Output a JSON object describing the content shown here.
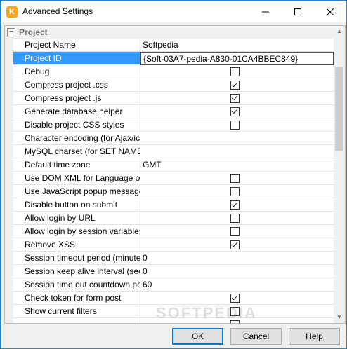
{
  "window": {
    "title": "Advanced Settings"
  },
  "titlebar": {
    "minimize": "—",
    "maximize": "☐",
    "close": "✕"
  },
  "category": {
    "label": "Project",
    "toggle": "−"
  },
  "rows": [
    {
      "name": "Project Name",
      "value": "Softpedia"
    },
    {
      "name": "Project ID",
      "value": "{Soft-03A7-pedia-A830-01CA4BBEC849}",
      "selected": true
    },
    {
      "name": "Debug",
      "checkbox": false
    },
    {
      "name": "Compress project .css",
      "checkbox": true
    },
    {
      "name": "Compress project .js",
      "checkbox": true
    },
    {
      "name": "Generate database helper",
      "checkbox": true
    },
    {
      "name": "Disable project CSS styles",
      "checkbox": false
    },
    {
      "name": "Character encoding (for Ajax/icon",
      "value": ""
    },
    {
      "name": "MySQL charset (for SET NAMES)",
      "value": ""
    },
    {
      "name": "Default time zone",
      "value": "GMT"
    },
    {
      "name": "Use DOM XML for Language objec",
      "checkbox": false
    },
    {
      "name": "Use JavaScript popup message",
      "checkbox": false
    },
    {
      "name": "Disable button on submit",
      "checkbox": true
    },
    {
      "name": "Allow login by URL",
      "checkbox": false
    },
    {
      "name": "Allow login by session variables",
      "checkbox": false
    },
    {
      "name": "Remove XSS",
      "checkbox": true
    },
    {
      "name": "Session timeout period (minutes)",
      "value": "0"
    },
    {
      "name": "Session keep alive interval (secon",
      "value": "0"
    },
    {
      "name": "Session time out countdown perio",
      "value": "60"
    },
    {
      "name": "Check token for form post",
      "checkbox": true
    },
    {
      "name": "Show current filters",
      "checkbox": false
    },
    {
      "name": "",
      "checkbox": false
    }
  ],
  "watermark": "SOFTPEDIA",
  "buttons": {
    "ok": "OK",
    "cancel": "Cancel",
    "help": "Help"
  },
  "icons": {
    "app": "app-icon",
    "scroll_up": "▲",
    "scroll_down": "▼"
  },
  "colors": {
    "selection": "#3399ff",
    "accent": "#0078d7"
  }
}
